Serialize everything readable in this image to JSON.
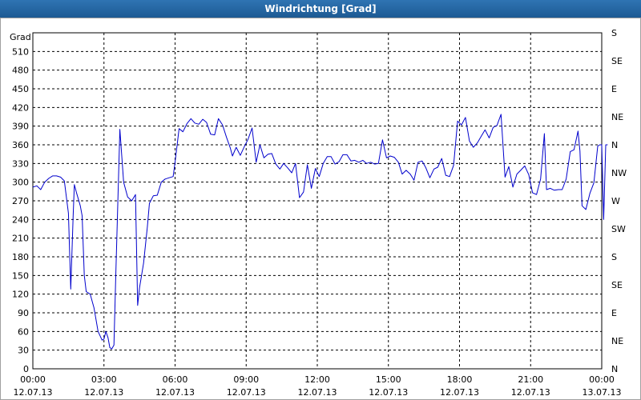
{
  "window": {
    "title": "Windrichtung [Grad]"
  },
  "chart_data": {
    "type": "line",
    "title": "Windrichtung [Grad]",
    "ylabel": "Grad",
    "ylim": [
      0,
      540
    ],
    "y_ticks": [
      "0",
      "30",
      "60",
      "90",
      "120",
      "150",
      "180",
      "210",
      "240",
      "270",
      "300",
      "330",
      "360",
      "390",
      "420",
      "450",
      "480",
      "510"
    ],
    "y2_ticks": [
      "N",
      "NE",
      "E",
      "SE",
      "S",
      "SW",
      "W",
      "NW",
      "N",
      "NE",
      "E",
      "SE",
      "S"
    ],
    "x_ticks": [
      {
        "time": "00:00",
        "date": "12.07.13"
      },
      {
        "time": "03:00",
        "date": "12.07.13"
      },
      {
        "time": "06:00",
        "date": "12.07.13"
      },
      {
        "time": "09:00",
        "date": "12.07.13"
      },
      {
        "time": "12:00",
        "date": "12.07.13"
      },
      {
        "time": "15:00",
        "date": "12.07.13"
      },
      {
        "time": "18:00",
        "date": "12.07.13"
      },
      {
        "time": "21:00",
        "date": "12.07.13"
      },
      {
        "time": "00:00",
        "date": "13.07.13"
      }
    ],
    "xlim_hours": [
      0,
      24
    ],
    "grid": true,
    "line_color": "#0000cc",
    "series": [
      {
        "values": [
          [
            0.0,
            292
          ],
          [
            0.17,
            294
          ],
          [
            0.33,
            288
          ],
          [
            0.5,
            300
          ],
          [
            0.67,
            306
          ],
          [
            0.83,
            310
          ],
          [
            1.0,
            310
          ],
          [
            1.17,
            308
          ],
          [
            1.33,
            302
          ],
          [
            1.5,
            250
          ],
          [
            1.6,
            128
          ],
          [
            1.7,
            246
          ],
          [
            1.75,
            296
          ],
          [
            1.85,
            282
          ],
          [
            2.0,
            262
          ],
          [
            2.08,
            246
          ],
          [
            2.17,
            150
          ],
          [
            2.25,
            124
          ],
          [
            2.42,
            120
          ],
          [
            2.58,
            98
          ],
          [
            2.75,
            60
          ],
          [
            2.92,
            46
          ],
          [
            3.0,
            48
          ],
          [
            3.08,
            60
          ],
          [
            3.17,
            50
          ],
          [
            3.25,
            34
          ],
          [
            3.33,
            32
          ],
          [
            3.42,
            38
          ],
          [
            3.5,
            150
          ],
          [
            3.58,
            260
          ],
          [
            3.67,
            385
          ],
          [
            3.83,
            300
          ],
          [
            4.0,
            276
          ],
          [
            4.17,
            270
          ],
          [
            4.33,
            280
          ],
          [
            4.42,
            102
          ],
          [
            4.5,
            130
          ],
          [
            4.67,
            170
          ],
          [
            4.83,
            228
          ],
          [
            4.92,
            266
          ],
          [
            5.08,
            278
          ],
          [
            5.25,
            279
          ],
          [
            5.42,
            300
          ],
          [
            5.58,
            305
          ],
          [
            5.75,
            307
          ],
          [
            5.92,
            309
          ],
          [
            6.0,
            332
          ],
          [
            6.17,
            386
          ],
          [
            6.33,
            381
          ],
          [
            6.5,
            394
          ],
          [
            6.67,
            402
          ],
          [
            6.83,
            395
          ],
          [
            7.0,
            393
          ],
          [
            7.17,
            401
          ],
          [
            7.33,
            396
          ],
          [
            7.5,
            377
          ],
          [
            7.67,
            376
          ],
          [
            7.83,
            402
          ],
          [
            8.0,
            392
          ],
          [
            8.17,
            372
          ],
          [
            8.33,
            355
          ],
          [
            8.42,
            342
          ],
          [
            8.58,
            356
          ],
          [
            8.75,
            343
          ],
          [
            8.92,
            357
          ],
          [
            9.08,
            369
          ],
          [
            9.25,
            387
          ],
          [
            9.42,
            332
          ],
          [
            9.58,
            360
          ],
          [
            9.75,
            339
          ],
          [
            9.92,
            345
          ],
          [
            10.08,
            346
          ],
          [
            10.25,
            329
          ],
          [
            10.42,
            321
          ],
          [
            10.58,
            330
          ],
          [
            10.75,
            323
          ],
          [
            10.92,
            315
          ],
          [
            11.08,
            330
          ],
          [
            11.25,
            275
          ],
          [
            11.42,
            284
          ],
          [
            11.58,
            328
          ],
          [
            11.75,
            290
          ],
          [
            11.92,
            322
          ],
          [
            12.08,
            309
          ],
          [
            12.25,
            330
          ],
          [
            12.42,
            341
          ],
          [
            12.58,
            341
          ],
          [
            12.75,
            329
          ],
          [
            12.92,
            333
          ],
          [
            13.08,
            344
          ],
          [
            13.25,
            344
          ],
          [
            13.42,
            334
          ],
          [
            13.58,
            335
          ],
          [
            13.75,
            332
          ],
          [
            13.92,
            335
          ],
          [
            14.08,
            330
          ],
          [
            14.25,
            332
          ],
          [
            14.42,
            329
          ],
          [
            14.58,
            330
          ],
          [
            14.75,
            368
          ],
          [
            14.92,
            339
          ],
          [
            15.08,
            342
          ],
          [
            15.25,
            340
          ],
          [
            15.42,
            332
          ],
          [
            15.58,
            313
          ],
          [
            15.75,
            319
          ],
          [
            15.92,
            313
          ],
          [
            16.08,
            303
          ],
          [
            16.25,
            332
          ],
          [
            16.42,
            334
          ],
          [
            16.58,
            323
          ],
          [
            16.75,
            307
          ],
          [
            16.92,
            321
          ],
          [
            17.08,
            324
          ],
          [
            17.25,
            338
          ],
          [
            17.42,
            311
          ],
          [
            17.58,
            309
          ],
          [
            17.75,
            327
          ],
          [
            17.92,
            398
          ],
          [
            18.08,
            392
          ],
          [
            18.25,
            404
          ],
          [
            18.42,
            366
          ],
          [
            18.58,
            356
          ],
          [
            18.75,
            363
          ],
          [
            18.92,
            374
          ],
          [
            19.08,
            384
          ],
          [
            19.25,
            371
          ],
          [
            19.42,
            388
          ],
          [
            19.58,
            391
          ],
          [
            19.75,
            409
          ],
          [
            19.92,
            308
          ],
          [
            20.08,
            325
          ],
          [
            20.25,
            292
          ],
          [
            20.42,
            313
          ],
          [
            20.58,
            319
          ],
          [
            20.75,
            326
          ],
          [
            20.92,
            312
          ],
          [
            21.08,
            283
          ],
          [
            21.25,
            280
          ],
          [
            21.42,
            305
          ],
          [
            21.58,
            378
          ],
          [
            21.67,
            288
          ],
          [
            21.83,
            290
          ],
          [
            22.0,
            287
          ],
          [
            22.17,
            288
          ],
          [
            22.33,
            288
          ],
          [
            22.5,
            305
          ],
          [
            22.67,
            349
          ],
          [
            22.83,
            352
          ],
          [
            23.0,
            382
          ],
          [
            23.08,
            350
          ],
          [
            23.17,
            262
          ],
          [
            23.33,
            256
          ],
          [
            23.5,
            282
          ],
          [
            23.67,
            299
          ],
          [
            23.83,
            358
          ],
          [
            23.92,
            360
          ],
          [
            24.0,
            360
          ],
          [
            24.08,
            240
          ],
          [
            24.17,
            360
          ],
          [
            24.25,
            360
          ]
        ]
      }
    ]
  }
}
